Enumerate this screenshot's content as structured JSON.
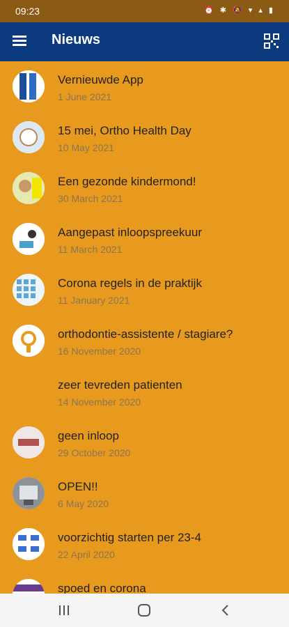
{
  "status": {
    "time": "09:23",
    "icons": "⏰ ✱ 🔕 ▾ ▴ ▮"
  },
  "appbar": {
    "title": "Nieuws",
    "menu_icon": "hamburger-menu-icon",
    "qr_icon": "qr-code-icon"
  },
  "news": [
    {
      "title": "Vernieuwde App",
      "date": "1 June 2021",
      "thumb": "app-screenshot"
    },
    {
      "title": "15 mei, Ortho Health Day",
      "date": "10 May 2021",
      "thumb": "event-badge"
    },
    {
      "title": "Een gezonde kindermond!",
      "date": "30 March 2021",
      "thumb": "child-photo"
    },
    {
      "title": "Aangepast inloopspreekuur",
      "date": "11 March 2021",
      "thumb": "doctor-illustration"
    },
    {
      "title": "Corona regels in de praktijk",
      "date": "11 January 2021",
      "thumb": "rules-grid"
    },
    {
      "title": "orthodontie-assistente / stagiare?",
      "date": "16 November 2020",
      "thumb": "logo"
    },
    {
      "title": "zeer tevreden patienten",
      "date": "14 November 2020",
      "thumb": ""
    },
    {
      "title": "geen inloop",
      "date": "29 October 2020",
      "thumb": "hands-photo"
    },
    {
      "title": "OPEN!!",
      "date": "6 May 2020",
      "thumb": "clinic-photo"
    },
    {
      "title": "voorzichtig starten per 23-4",
      "date": "22 April 2020",
      "thumb": "diagram"
    },
    {
      "title": "spoed en corona",
      "date": "",
      "thumb": "banner"
    }
  ],
  "navbar": {
    "recents_icon": "recents-icon",
    "home_icon": "home-icon",
    "back_icon": "back-icon"
  }
}
